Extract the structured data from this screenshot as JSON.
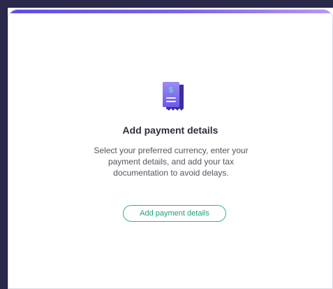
{
  "empty_state": {
    "icon": "receipt-dollar-icon",
    "title": "Add payment details",
    "description": "Select your preferred currency, enter your payment details, and add your tax documentation to avoid delays.",
    "button_label": "Add payment details"
  },
  "colors": {
    "accent_start": "#5b4fe0",
    "accent_end": "#b898f0",
    "icon_purple": "#6f5ae8",
    "button_green": "#2bb58a"
  }
}
